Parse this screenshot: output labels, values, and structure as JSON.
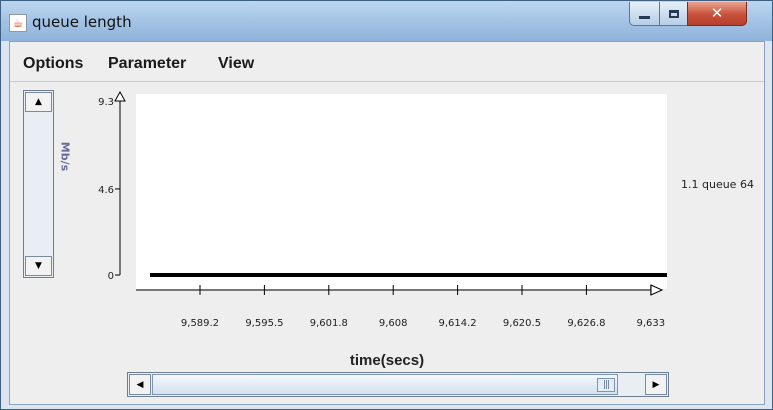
{
  "window": {
    "title": "queue length",
    "app_icon": "java-cup-icon",
    "controls": {
      "minimize": "minimize-icon",
      "maximize": "maximize-icon",
      "close": "✕"
    }
  },
  "menu": {
    "items": [
      "Options",
      "Parameter",
      "View"
    ]
  },
  "legend": {
    "label": "1.1 queue 64"
  },
  "chart_data": {
    "type": "line",
    "ylabel": "Mb/s",
    "xlabel": "time(secs)",
    "y_ticks": [
      "9.3",
      "4.6",
      "0"
    ],
    "x_ticks": [
      "9,589.2",
      "9,595.5",
      "9,601.8",
      "9,608",
      "9,614.2",
      "9,620.5",
      "9,626.8",
      "9,633"
    ],
    "ylim": [
      0,
      9.3
    ],
    "xlim": [
      9583,
      9633
    ],
    "series": [
      {
        "name": "1.1 queue 64",
        "color": "#000000",
        "x": [
          9583,
          9633
        ],
        "y": [
          0,
          0
        ]
      }
    ]
  },
  "scrollbars": {
    "vertical": {
      "up_arrow": "▲",
      "down_arrow": "▼"
    },
    "horizontal": {
      "left_arrow": "◀",
      "right_arrow": "▶",
      "grip": "|||",
      "position": 1.0
    }
  },
  "colors": {
    "titlebar": "#a6c5e6",
    "client": "#eeeeee",
    "plot": "#ffffff",
    "series": "#000000"
  }
}
